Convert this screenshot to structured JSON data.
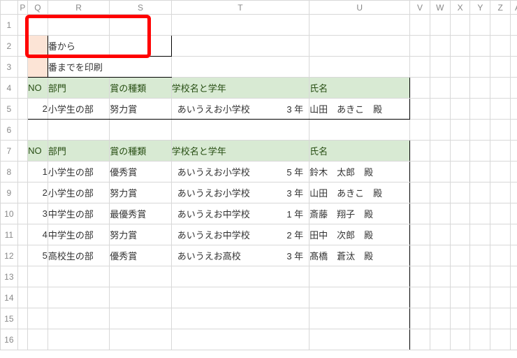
{
  "columns": {
    "P": "P",
    "Q": "Q",
    "R": "R",
    "S": "S",
    "T": "T",
    "U": "U",
    "V": "V",
    "W": "W",
    "X": "X",
    "Y": "Y",
    "Z": "Z",
    "AA": "AA"
  },
  "rows": {
    "r1": "1",
    "r2": "2",
    "r3": "3",
    "r4": "4",
    "r5": "5",
    "r6": "6",
    "r7": "7",
    "r8": "8",
    "r9": "9",
    "r10": "10",
    "r11": "11",
    "r12": "12",
    "r13": "13",
    "r14": "14",
    "r15": "15",
    "r16": "16"
  },
  "print": {
    "from_label": "番から",
    "to_label": "番までを印刷"
  },
  "headers": {
    "no": "NO",
    "bumon": "部門",
    "award": "賞の種類",
    "school": "学校名と学年",
    "name": "氏名"
  },
  "single": {
    "no": "2",
    "bumon": "小学生の部",
    "award": "努力賞",
    "school": "あいうえお小学校",
    "grade": "3 年",
    "name": "山田　あきこ　殿"
  },
  "list": [
    {
      "no": "1",
      "bumon": "小学生の部",
      "award": "優秀賞",
      "school": "あいうえお小学校",
      "grade": "5 年",
      "name": "鈴木　太郎　殿"
    },
    {
      "no": "2",
      "bumon": "小学生の部",
      "award": "努力賞",
      "school": "あいうえお小学校",
      "grade": "3 年",
      "name": "山田　あきこ　殿"
    },
    {
      "no": "3",
      "bumon": "中学生の部",
      "award": "最優秀賞",
      "school": "あいうえお中学校",
      "grade": "1 年",
      "name": "斎藤　翔子　殿"
    },
    {
      "no": "4",
      "bumon": "中学生の部",
      "award": "努力賞",
      "school": "あいうえお中学校",
      "grade": "2 年",
      "name": "田中　次郎　殿"
    },
    {
      "no": "5",
      "bumon": "高校生の部",
      "award": "優秀賞",
      "school": "あいうえお高校",
      "grade": "3 年",
      "name": "髙橋　蒼汰　殿"
    }
  ],
  "chart_data": {
    "type": "table",
    "title": "賞リスト",
    "columns": [
      "NO",
      "部門",
      "賞の種類",
      "学校名と学年",
      "氏名"
    ],
    "rows": [
      [
        1,
        "小学生の部",
        "優秀賞",
        "あいうえお小学校 5年",
        "鈴木 太郎 殿"
      ],
      [
        2,
        "小学生の部",
        "努力賞",
        "あいうえお小学校 3年",
        "山田 あきこ 殿"
      ],
      [
        3,
        "中学生の部",
        "最優秀賞",
        "あいうえお中学校 1年",
        "斎藤 翔子 殿"
      ],
      [
        4,
        "中学生の部",
        "努力賞",
        "あいうえお中学校 2年",
        "田中 次郎 殿"
      ],
      [
        5,
        "高校生の部",
        "優秀賞",
        "あいうえお高校 3年",
        "髙橋 蒼汰 殿"
      ]
    ]
  }
}
